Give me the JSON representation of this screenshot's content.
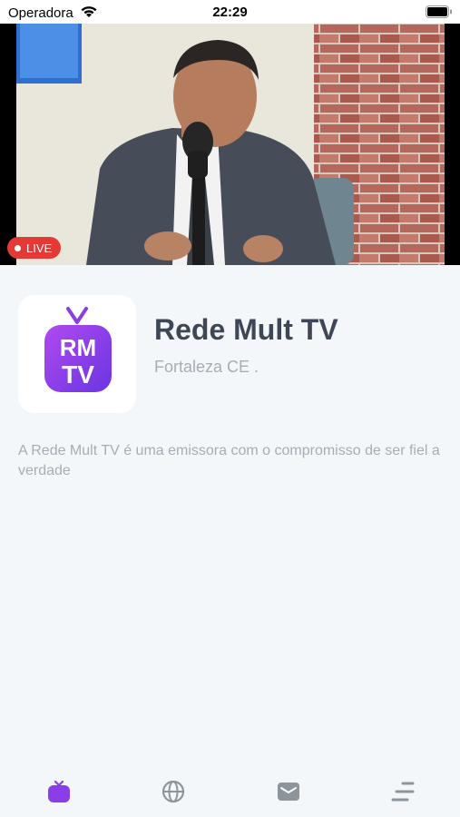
{
  "status_bar": {
    "carrier": "Operadora",
    "time": "22:29"
  },
  "video": {
    "live_label": "LIVE"
  },
  "channel": {
    "name": "Rede Mult TV",
    "location": "Fortaleza CE .",
    "description": "A Rede Mult TV é uma emissora com o compromisso de ser fiel a verdade",
    "logo_text_top": "RM",
    "logo_text_bottom": "TV"
  },
  "tabs": [
    {
      "icon": "tv-icon",
      "active": true
    },
    {
      "icon": "globe-icon",
      "active": false
    },
    {
      "icon": "mail-icon",
      "active": false
    },
    {
      "icon": "menu-icon",
      "active": false
    }
  ],
  "colors": {
    "accent": "#8a3ee8",
    "live": "#e53935",
    "inactive_icon": "#8c949c"
  }
}
